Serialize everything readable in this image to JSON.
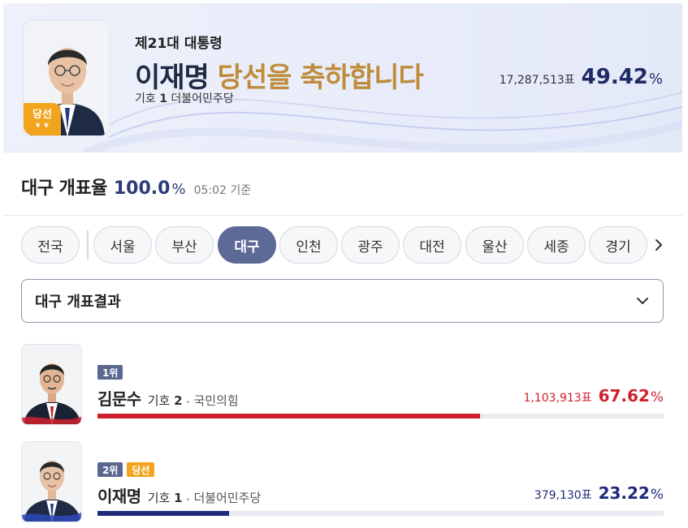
{
  "banner": {
    "subtitle": "제21대 대통령",
    "name": "이재명",
    "congrats": " 당선을 축하합니다",
    "badge": "당선",
    "number_label": "기호",
    "number": "1",
    "party": "더불어민주당",
    "votes": "17,287,513표",
    "percent": "49.42",
    "percent_sign": "%"
  },
  "count_rate": {
    "title": "대구 개표율",
    "value": "100.0",
    "percent_sign": "%",
    "time": "05:02 기준"
  },
  "tabs": [
    {
      "label": "전국"
    },
    {
      "label": "서울"
    },
    {
      "label": "부산"
    },
    {
      "label": "대구",
      "active": true
    },
    {
      "label": "인천"
    },
    {
      "label": "광주"
    },
    {
      "label": "대전"
    },
    {
      "label": "울산"
    },
    {
      "label": "세종"
    },
    {
      "label": "경기"
    }
  ],
  "dropdown": {
    "label": "대구 개표결과"
  },
  "candidates": [
    {
      "rank": "1위",
      "name": "김문수",
      "number_label": "기호",
      "number": "2",
      "party": "국민의힘",
      "votes": "1,103,913표",
      "percent": "67.62",
      "percent_sign": "%",
      "share": 67.62,
      "color": "#d0202f",
      "elected": false
    },
    {
      "rank": "2위",
      "elected_label": "당선",
      "name": "이재명",
      "number_label": "기호",
      "number": "1",
      "party": "더불어민주당",
      "votes": "379,130표",
      "percent": "23.22",
      "percent_sign": "%",
      "share": 23.22,
      "color": "#1f2a7a",
      "elected": true
    }
  ]
}
